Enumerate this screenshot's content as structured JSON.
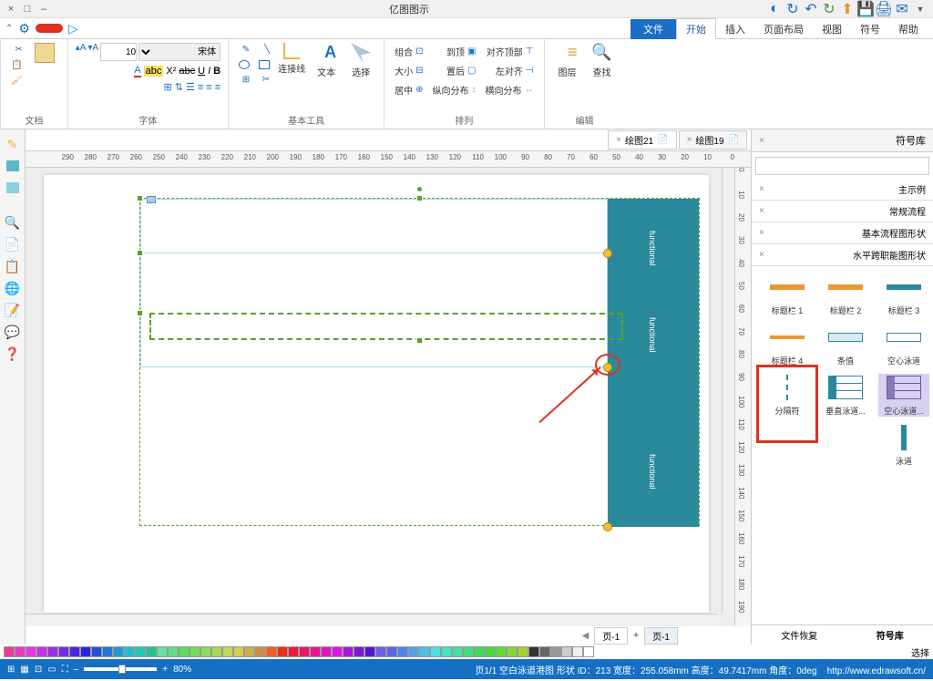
{
  "title": "亿图图示",
  "qat": {
    "minimize": "–",
    "maximize": "□",
    "close": "×"
  },
  "tabs": {
    "file": "文件",
    "items": [
      "开始",
      "插入",
      "页面布局",
      "视图",
      "符号",
      "帮助"
    ],
    "active": "开始"
  },
  "ribbon": {
    "file_group": "文档",
    "font": {
      "label": "字体",
      "family": "宋体",
      "size": "10",
      "bold": "B",
      "italic": "I",
      "underline": "U",
      "strike": "abc",
      "super": "X²",
      "highlight": "abc",
      "color": "A"
    },
    "tools": {
      "label": "基本工具",
      "select": "选择",
      "text": "文本",
      "connector": "连接线",
      "shapes": "基本图形"
    },
    "arrange": {
      "label": "排列",
      "align": "对齐顶部",
      "left": "左对齐",
      "dist_h": "横向分布",
      "dist_v": "纵向分布",
      "front": "到顶",
      "back": "置后",
      "group": "组合",
      "size": "大小",
      "center": "居中"
    },
    "edit": {
      "label": "编辑",
      "find": "查找",
      "replace": "图层"
    }
  },
  "doc_tabs": [
    {
      "name": "绘图19",
      "icon": "📄"
    },
    {
      "name": "绘图21",
      "icon": "📄",
      "active": true
    }
  ],
  "ruler_h": [
    0,
    10,
    20,
    30,
    40,
    50,
    60,
    70,
    80,
    90,
    100,
    110,
    120,
    130,
    140,
    150,
    160,
    170,
    180,
    190,
    200,
    210,
    220,
    230,
    240,
    250,
    260,
    270,
    280,
    290
  ],
  "ruler_v": [
    0,
    10,
    20,
    30,
    40,
    50,
    60,
    70,
    80,
    90,
    100,
    110,
    120,
    130,
    140,
    150,
    160,
    170,
    180,
    190
  ],
  "canvas_shapes": {
    "txt1": "functional",
    "txt2": "functional",
    "txt3": "functional"
  },
  "page_tabs": {
    "page1": "页-1",
    "page_other": "页-1",
    "add": "+"
  },
  "right_panel": {
    "title": "符号库",
    "search_placeholder": "",
    "sections": [
      "主示例",
      "常规流程",
      "基本流程图形状",
      "水平跨职能图形状"
    ],
    "shapes": [
      {
        "name": "标题栏 1"
      },
      {
        "name": "标题栏 2"
      },
      {
        "name": "标题栏 3"
      },
      {
        "name": "标题栏 4"
      },
      {
        "name": "条值"
      },
      {
        "name": "空心泳道"
      },
      {
        "name": "分隔符"
      },
      {
        "name": "垂直泳道..."
      },
      {
        "name": "空心泳道..."
      },
      {
        "name": "泳道"
      }
    ],
    "footer_tabs": [
      "符号库",
      "文件恢复"
    ]
  },
  "color_label": "选择",
  "status": {
    "zoom": "80%",
    "plus": "+",
    "minus": "–",
    "info": "页1/1  空白泳道港图  形状 ID：213  宽度：255.058mm  高度：49.7417mm  角度：0deg",
    "url": "http://www.edrawsoft.cn/"
  }
}
